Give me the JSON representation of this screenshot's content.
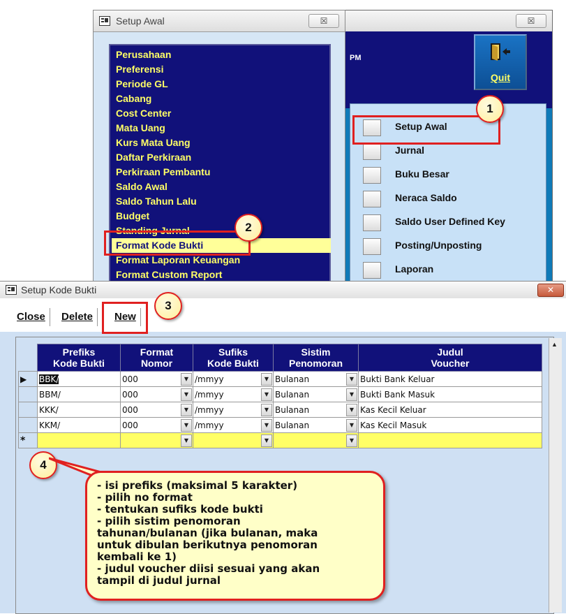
{
  "main_window": {
    "close_label": "☒",
    "partial_text": "PM",
    "quit_label": "Quit",
    "menu": [
      {
        "label": "Setup Awal"
      },
      {
        "label": "Jurnal"
      },
      {
        "label": "Buku Besar"
      },
      {
        "label": "Neraca Saldo"
      },
      {
        "label": "Saldo User Defined Key"
      },
      {
        "label": "Posting/Unposting"
      },
      {
        "label": "Laporan"
      }
    ]
  },
  "setup_awal": {
    "title": "Setup Awal",
    "close_label": "☒",
    "items": [
      "Perusahaan",
      "Preferensi",
      "Periode GL",
      "Cabang",
      "Cost Center",
      "Mata Uang",
      "Kurs Mata Uang",
      "Daftar Perkiraan",
      "Perkiraan Pembantu",
      "Saldo Awal",
      "Saldo Tahun Lalu",
      "Budget",
      "Standing Jurnal",
      "Format Kode Bukti",
      "Format Laporan Keuangan",
      "Format Custom Report"
    ],
    "selected": "Format Kode Bukti"
  },
  "kode_bukti": {
    "title": "Setup Kode Bukti",
    "toolbar": {
      "close": "Close",
      "delete": "Delete",
      "new": "New"
    },
    "columns": [
      {
        "line1": "Prefiks",
        "line2": "Kode Bukti"
      },
      {
        "line1": "Format",
        "line2": "Nomor"
      },
      {
        "line1": "Sufiks",
        "line2": "Kode Bukti"
      },
      {
        "line1": "Sistim",
        "line2": "Penomoran"
      },
      {
        "line1": "Judul",
        "line2": "Voucher"
      }
    ],
    "rows": [
      {
        "prefix": "BBK/",
        "format": "000",
        "suffix": "/mmyy",
        "sistem": "Bulanan",
        "judul": "Bukti Bank Keluar"
      },
      {
        "prefix": "BBM/",
        "format": "000",
        "suffix": "/mmyy",
        "sistem": "Bulanan",
        "judul": "Bukti Bank Masuk"
      },
      {
        "prefix": "KKK/",
        "format": "000",
        "suffix": "/mmyy",
        "sistem": "Bulanan",
        "judul": "Kas Kecil Keluar"
      },
      {
        "prefix": "KKM/",
        "format": "000",
        "suffix": "/mmyy",
        "sistem": "Bulanan",
        "judul": "Kas Kecil Masuk"
      }
    ]
  },
  "callouts": {
    "n1": "1",
    "n2": "2",
    "n3": "3",
    "n4": "4",
    "note": "- isi prefiks (maksimal 5 karakter)\n- pilih no format\n- tentukan sufiks kode bukti\n- pilih sistim penomoran\ntahunan/bulanan (jika bulanan, maka\nuntuk dibulan berikutnya penomoran\nkembali ke 1)\n- judul voucher diisi sesuai yang akan\ntampil di judul jurnal"
  },
  "colors": {
    "navy": "#11117a",
    "list_text": "#ffff66",
    "highlight": "#ffff99",
    "callout_red": "#e02020",
    "note_bg": "#ffffc8"
  }
}
